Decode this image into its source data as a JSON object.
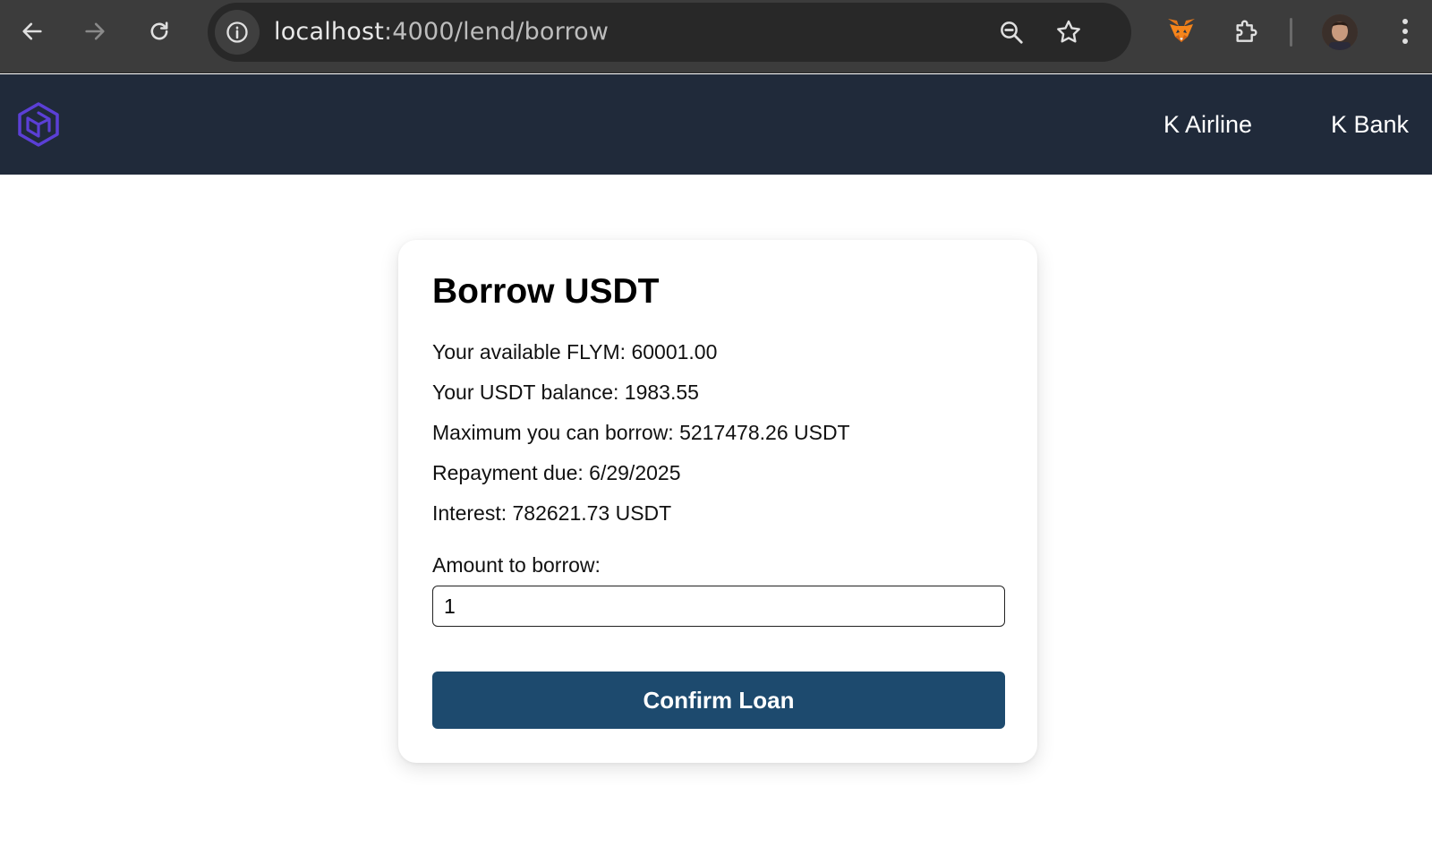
{
  "browser": {
    "url_host": "localhost",
    "url_path": ":4000/lend/borrow",
    "icons": {
      "back": "arrow-left-icon",
      "forward": "arrow-right-icon",
      "reload": "reload-icon",
      "site_info": "info-icon",
      "zoom": "zoom-icon",
      "bookmark": "star-icon",
      "metamask": "metamask-fox-icon",
      "extensions": "puzzle-icon",
      "menu": "kebab-menu-icon"
    }
  },
  "header": {
    "logo": "hexagon-logo",
    "nav": [
      {
        "label": "K Airline"
      },
      {
        "label": "K Bank"
      }
    ]
  },
  "card": {
    "title": "Borrow USDT",
    "lines": [
      {
        "label": "Your available FLYM: ",
        "value": "60001.00"
      },
      {
        "label": "Your USDT balance: ",
        "value": "1983.55"
      },
      {
        "label": "Maximum you can borrow: ",
        "value": "5217478.26 USDT"
      },
      {
        "label": "Repayment due: ",
        "value": "6/29/2025"
      },
      {
        "label": "Interest: ",
        "value": "782621.73 USDT"
      }
    ],
    "amount_label": "Amount to borrow:",
    "amount_value": "1",
    "confirm_label": "Confirm Loan"
  },
  "colors": {
    "header_bg": "#202a3a",
    "button_bg": "#1d4a6e",
    "logo_accent": "#5b3fd6"
  }
}
